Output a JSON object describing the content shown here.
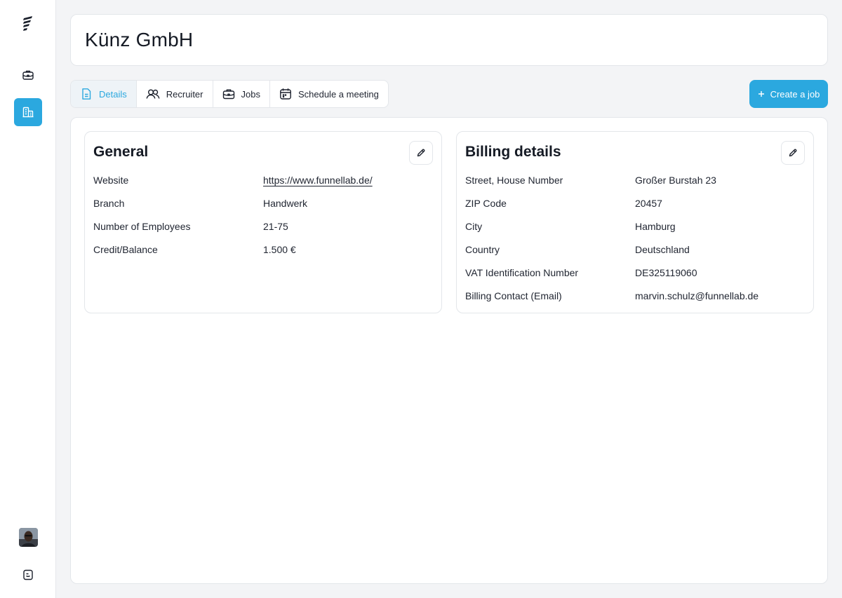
{
  "page": {
    "title": "Künz GmbH"
  },
  "sidebar": {
    "items": [
      {
        "icon": "briefcase-icon"
      },
      {
        "icon": "building-icon",
        "active": true
      },
      {
        "icon": "support-icon"
      }
    ]
  },
  "tabs": [
    {
      "label": "Details",
      "icon": "document-icon",
      "active": true
    },
    {
      "label": "Recruiter",
      "icon": "users-icon"
    },
    {
      "label": "Jobs",
      "icon": "briefcase-icon"
    },
    {
      "label": "Schedule a meeting",
      "icon": "calendar-icon"
    }
  ],
  "actions": {
    "create_job": "Create a job"
  },
  "general": {
    "title": "General",
    "rows": [
      {
        "label": "Website",
        "value": "https://www.funnellab.de/"
      },
      {
        "label": "Branch",
        "value": "Handwerk"
      },
      {
        "label": "Number of Employees",
        "value": "21-75"
      },
      {
        "label": "Credit/Balance",
        "value": "1.500 €"
      }
    ]
  },
  "billing": {
    "title": "Billing details",
    "rows": [
      {
        "label": "Street, House Number",
        "value": "Großer Burstah 23"
      },
      {
        "label": "ZIP Code",
        "value": "20457"
      },
      {
        "label": "City",
        "value": "Hamburg"
      },
      {
        "label": "Country",
        "value": "Deutschland"
      },
      {
        "label": "VAT Identification Number",
        "value": "DE325119060"
      },
      {
        "label": "Billing Contact (Email)",
        "value": "marvin.schulz@funnellab.de"
      }
    ]
  },
  "colors": {
    "accent": "#2ba8df",
    "background": "#f3f4f6",
    "border": "#e3e6ea"
  }
}
